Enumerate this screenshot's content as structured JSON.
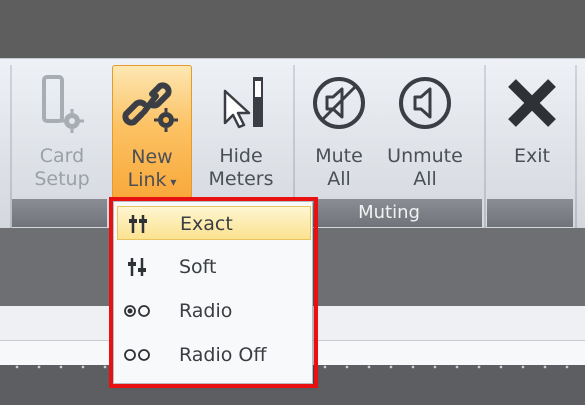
{
  "ribbon": {
    "buttons": {
      "card_setup": {
        "line1": "Card",
        "line2": "Setup",
        "enabled": false,
        "icon": "card-gear-icon"
      },
      "new_link": {
        "line1": "New",
        "line2": "Link",
        "has_dropdown": true,
        "pressed": true,
        "icon": "link-gear-icon"
      },
      "hide_meters": {
        "line1": "Hide",
        "line2": "Meters",
        "icon": "cursor-meter-icon"
      },
      "mute_all": {
        "line1": "Mute",
        "line2": "All",
        "icon": "speaker-muted-icon"
      },
      "unmute_all": {
        "line1": "Unmute",
        "line2": "All",
        "icon": "speaker-icon"
      },
      "exit": {
        "label": "Exit",
        "icon": "x-icon"
      }
    },
    "groups": {
      "muting": "Muting"
    }
  },
  "dropdown": {
    "items": [
      {
        "label": "Exact",
        "highlighted": true,
        "icon": "exact-faders-icon"
      },
      {
        "label": "Soft",
        "icon": "soft-faders-icon"
      },
      {
        "label": "Radio",
        "icon": "radio-selected-icon"
      },
      {
        "label": "Radio Off",
        "icon": "radio-off-icon"
      }
    ]
  },
  "colors": {
    "highlight_box": "#e81010",
    "active_button": "#f9a83a",
    "menu_highlight": "#fbe28f"
  }
}
